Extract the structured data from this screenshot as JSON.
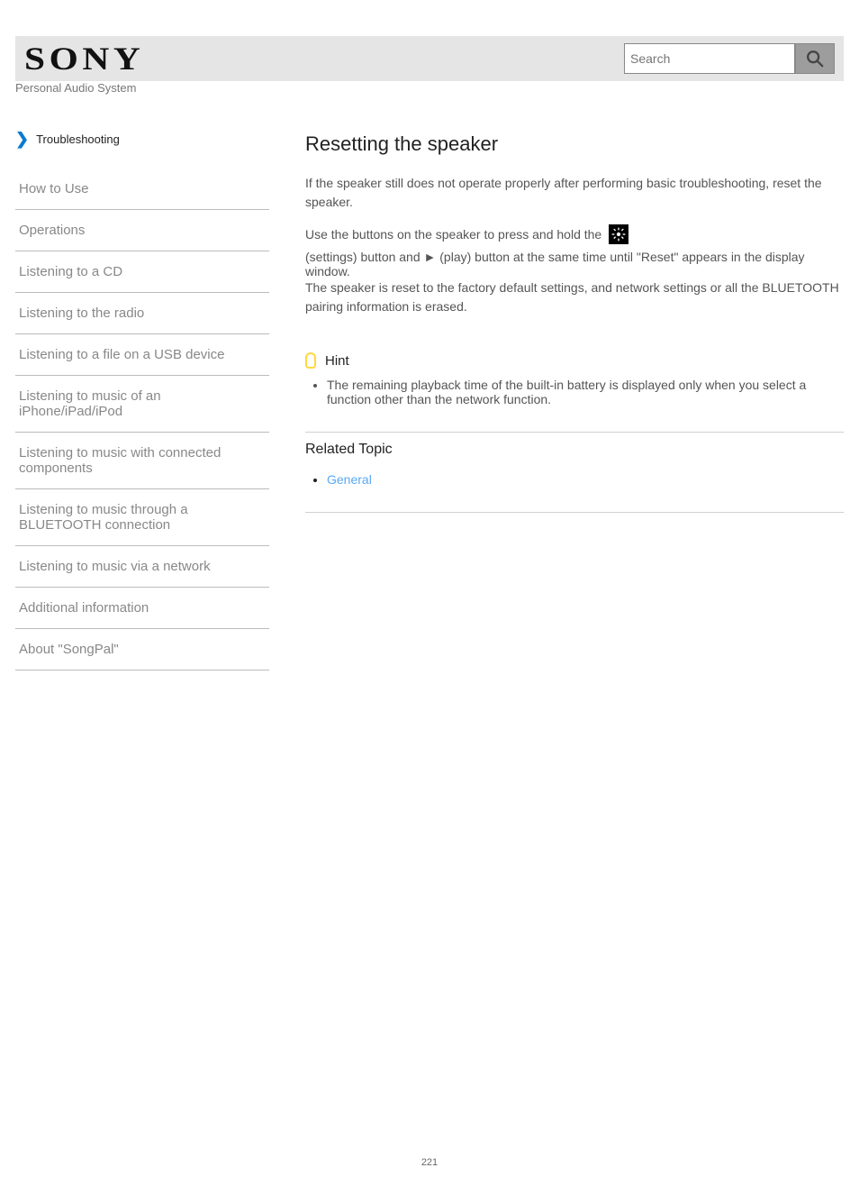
{
  "header": {
    "logo_text": "SONY",
    "search_placeholder": "Search",
    "search_button_label": "Search"
  },
  "site_title": "Personal Audio System",
  "breadcrumb": {
    "label": "Troubleshooting"
  },
  "sidebar": {
    "items": [
      "How to Use",
      "Operations",
      "Listening to a CD",
      "Listening to the radio",
      "Listening to a file on a USB device",
      "Listening to music of an iPhone/iPad/iPod",
      "Listening to music with connected components",
      "Listening to music through a BLUETOOTH connection",
      "Listening to music via a network",
      "Additional information",
      "About \"SongPal\""
    ]
  },
  "article": {
    "title": "Resetting the speaker",
    "p1": "If the speaker still does not operate properly after performing basic troubleshooting, reset the speaker.",
    "settings_before": "Use the buttons on the speaker to press and hold the",
    "settings_after": "(settings) button and ► (play) button at the same time until \"Reset\" appears in the display window.",
    "p2": "The speaker is reset to the factory default settings, and network settings or all the BLUETOOTH pairing information is erased.",
    "tip_label": "Hint",
    "bullets": [
      "The remaining playback time of the built-in battery is displayed only when you select a function other than the network function."
    ],
    "related_heading": "Related Topic",
    "related": [
      {
        "label": "General"
      }
    ]
  },
  "page_number": "221",
  "icons": {
    "search": "search-icon",
    "settings": "settings-icon",
    "hint": "hint-icon"
  }
}
